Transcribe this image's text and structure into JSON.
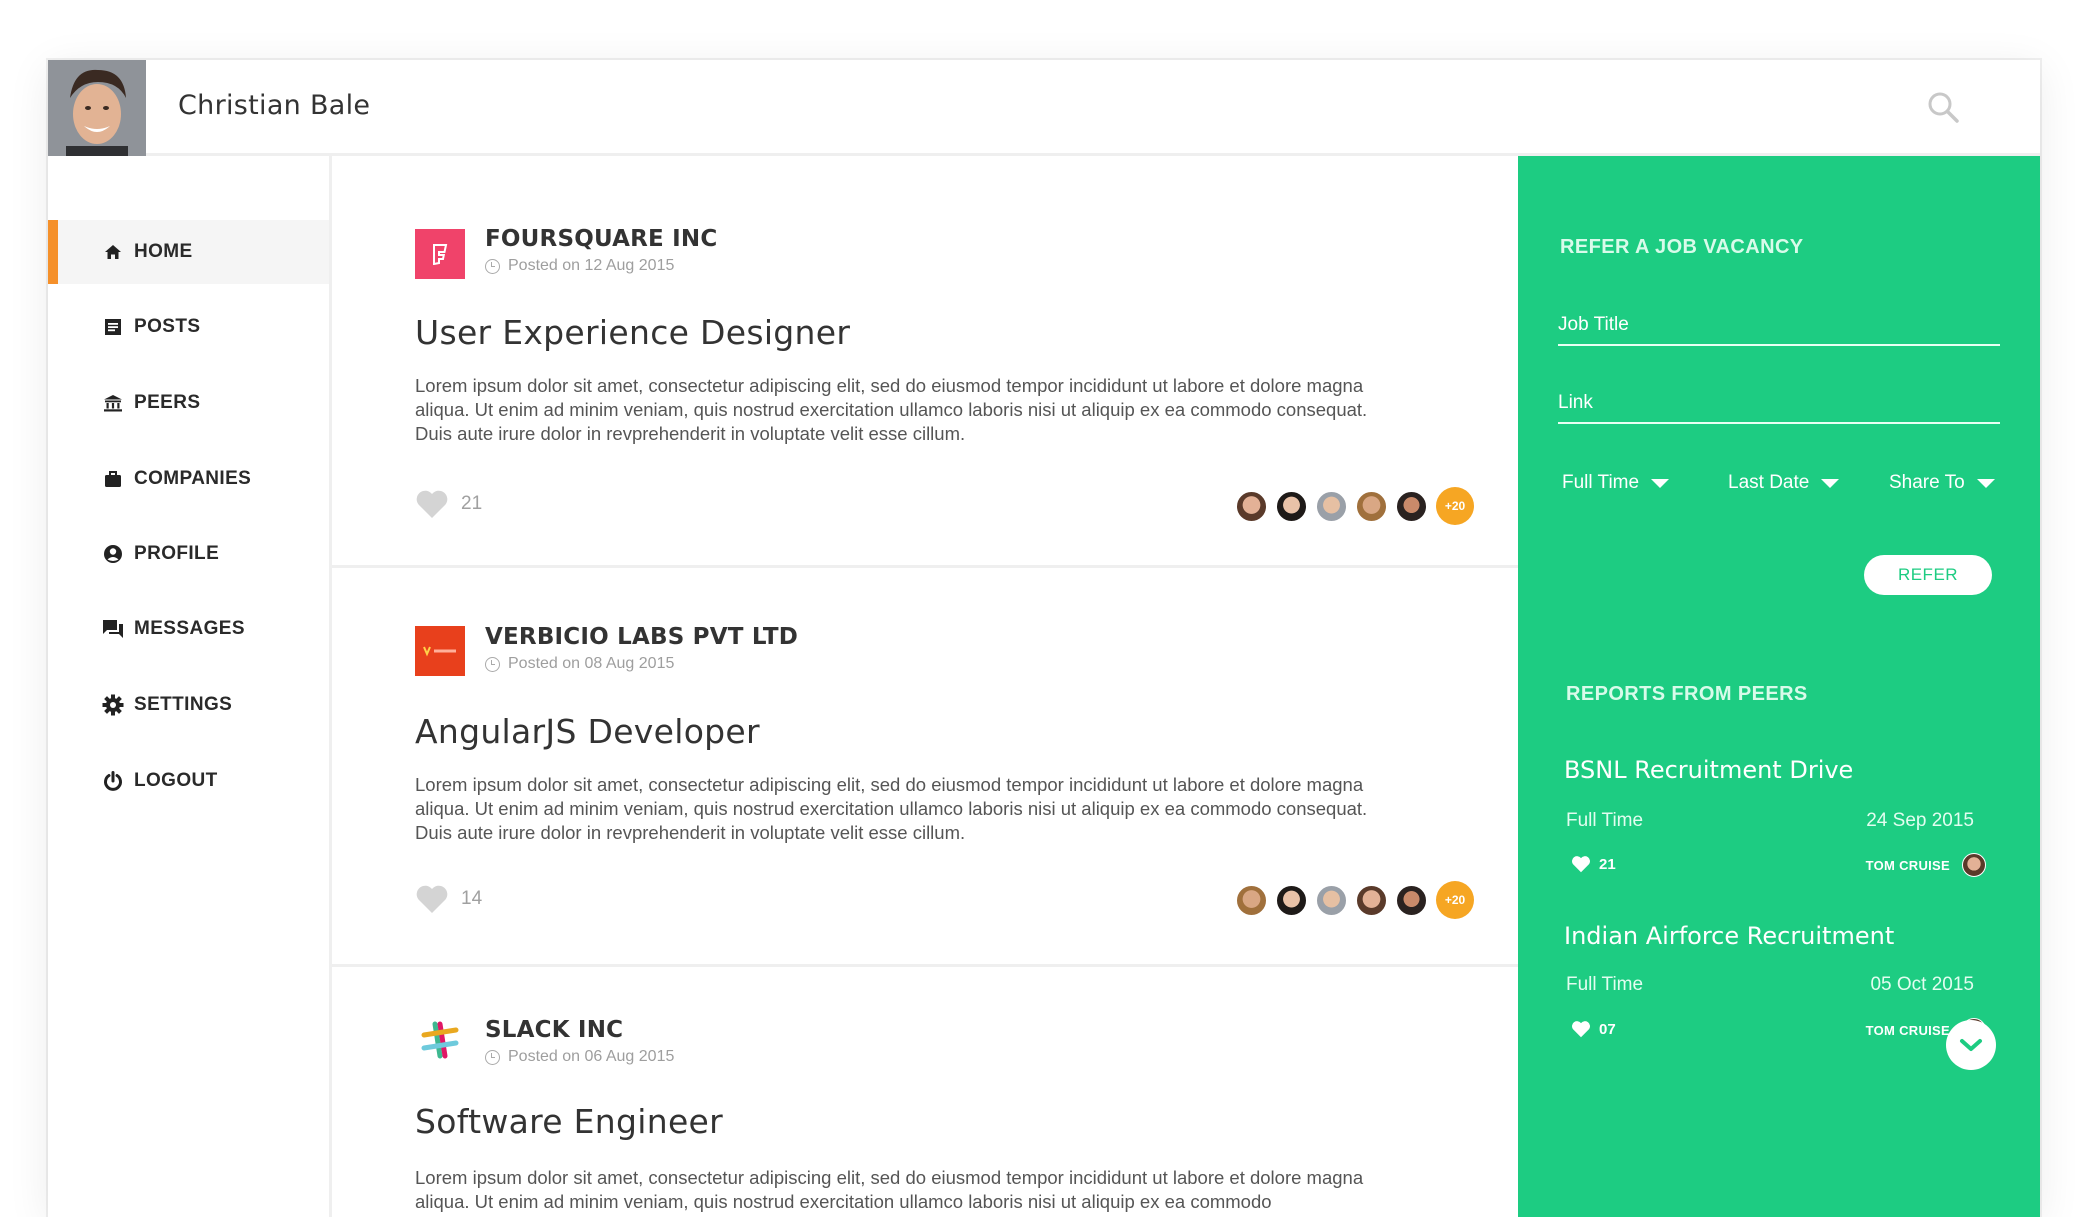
{
  "header": {
    "user_name": "Christian Bale",
    "search_icon": "search-icon"
  },
  "sidebar": {
    "items": [
      {
        "label": "HOME",
        "icon": "home-icon",
        "active": true
      },
      {
        "label": "POSTS",
        "icon": "posts-icon",
        "active": false
      },
      {
        "label": "PEERS",
        "icon": "peers-icon",
        "active": false
      },
      {
        "label": "COMPANIES",
        "icon": "briefcase-icon",
        "active": false
      },
      {
        "label": "PROFILE",
        "icon": "profile-icon",
        "active": false
      },
      {
        "label": "MESSAGES",
        "icon": "messages-icon",
        "active": false
      },
      {
        "label": "SETTINGS",
        "icon": "gear-icon",
        "active": false
      },
      {
        "label": "LOGOUT",
        "icon": "power-icon",
        "active": false
      }
    ],
    "accent": "#f5902a"
  },
  "feed": {
    "posts": [
      {
        "company": "FOURSQUARE INC",
        "posted": "Posted on 12 Aug 2015",
        "title": "User Experience Designer",
        "description": "Lorem ipsum dolor sit amet, consectetur adipiscing elit, sed do eiusmod tempor incididunt ut labore et dolore magna aliqua. Ut enim ad minim veniam, quis nostrud exercitation ullamco laboris nisi ut aliquip ex ea commodo consequat. Duis aute irure dolor in revprehenderit in voluptate velit esse cillum.",
        "likes": "21",
        "more_peers": "+20",
        "logo_color": "#f0436a"
      },
      {
        "company": "VERBICIO LABS PVT LTD",
        "posted": "Posted on 08 Aug 2015",
        "title": "AngularJS Developer",
        "description": "Lorem ipsum dolor sit amet, consectetur adipiscing elit, sed do eiusmod tempor incididunt ut labore et dolore magna aliqua. Ut enim ad minim veniam, quis nostrud exercitation ullamco laboris nisi ut aliquip ex ea commodo consequat. Duis aute irure dolor in revprehenderit in voluptate velit esse cillum.",
        "likes": "14",
        "more_peers": "+20",
        "logo_color": "#e8401c"
      },
      {
        "company": "SLACK INC",
        "posted": "Posted on 06 Aug 2015",
        "title": "Software Engineer",
        "description": "Lorem ipsum dolor sit amet, consectetur adipiscing elit, sed do eiusmod tempor incididunt ut labore et dolore magna aliqua. Ut enim ad minim veniam, quis nostrud exercitation ullamco laboris nisi ut aliquip ex ea commodo"
      }
    ]
  },
  "panel": {
    "refer_heading": "REFER A JOB VACANCY",
    "job_title_label": "Job Title",
    "link_label": "Link",
    "dropdowns": [
      "Full Time",
      "Last Date",
      "Share To"
    ],
    "refer_button": "REFER",
    "reports_heading": "REPORTS FROM PEERS",
    "reports": [
      {
        "title": "BSNL Recruitment Drive",
        "type": "Full Time",
        "date": "24 Sep 2015",
        "likes": "21",
        "by": "TOM CRUISE"
      },
      {
        "title": "Indian Airforce Recruitment",
        "type": "Full Time",
        "date": "05 Oct 2015",
        "likes": "07",
        "by": "TOM CRUISE"
      }
    ],
    "bg_color": "#1dcc82"
  }
}
